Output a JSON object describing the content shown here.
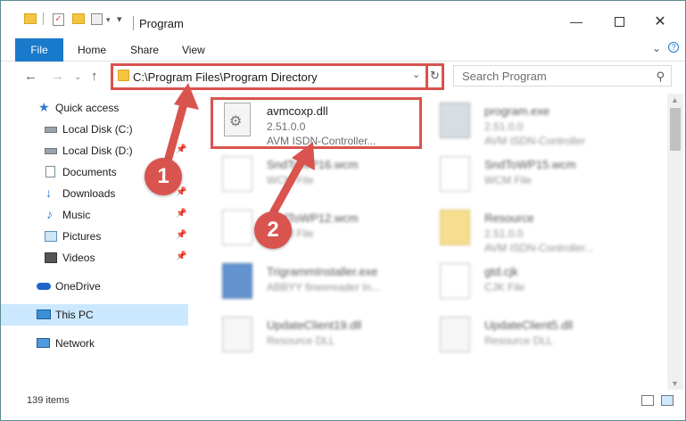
{
  "window": {
    "title": "Program"
  },
  "ribbon": {
    "tabs": [
      {
        "label": "File"
      },
      {
        "label": "Home"
      },
      {
        "label": "Share"
      },
      {
        "label": "View"
      }
    ]
  },
  "address": {
    "path": "C:\\Program Files\\Program Directory"
  },
  "search": {
    "placeholder": "Search Program"
  },
  "sidebar": {
    "items": [
      {
        "label": "Quick access",
        "icon": "star-icon"
      },
      {
        "label": "Local Disk (C:)",
        "icon": "drive-icon"
      },
      {
        "label": "Local Disk (D:)",
        "icon": "drive-icon"
      },
      {
        "label": "Documents",
        "icon": "documents-icon"
      },
      {
        "label": "Downloads",
        "icon": "downloads-icon"
      },
      {
        "label": "Music",
        "icon": "music-icon"
      },
      {
        "label": "Pictures",
        "icon": "pictures-icon"
      },
      {
        "label": "Videos",
        "icon": "videos-icon"
      },
      {
        "label": "OneDrive",
        "icon": "cloud-icon"
      },
      {
        "label": "This PC",
        "icon": "computer-icon"
      },
      {
        "label": "Network",
        "icon": "network-icon"
      }
    ]
  },
  "files": [
    {
      "name": "avmcoxp.dll",
      "line1": "2.51.0.0",
      "line2": "AVM ISDN-Controller...",
      "icon": "dll-icon"
    },
    {
      "name": "program.exe",
      "line1": "2.51.0.0",
      "line2": "AVM ISDN-Controller",
      "icon": "exe-icon"
    },
    {
      "name": "SndToWP16.wcm",
      "line1": "WCM File",
      "line2": "",
      "icon": "document-icon"
    },
    {
      "name": "SndToWP15.wcm",
      "line1": "WCM File",
      "line2": "",
      "icon": "document-icon"
    },
    {
      "name": "SndToWP12.wcm",
      "line1": "WCM File",
      "line2": "",
      "icon": "document-icon"
    },
    {
      "name": "Resource",
      "line1": "2.51.0.0",
      "line2": "AVM ISDN-Controller...",
      "icon": "resource-icon"
    },
    {
      "name": "TrigrammInstaller.exe",
      "line1": "ABBYY fineereader In...",
      "line2": "",
      "icon": "installer-icon"
    },
    {
      "name": "gtd.cjk",
      "line1": "CJK File",
      "line2": "",
      "icon": "document-icon"
    },
    {
      "name": "UpdateClient19.dll",
      "line1": "Resource DLL",
      "line2": "",
      "icon": "dll-icon"
    },
    {
      "name": "UpdateClient5.dll",
      "line1": "Resource DLL",
      "line2": "",
      "icon": "dll-icon"
    }
  ],
  "status": {
    "item_count": "139 items"
  },
  "callouts": {
    "step1": "1",
    "step2": "2",
    "accent_color": "#d9534f"
  }
}
